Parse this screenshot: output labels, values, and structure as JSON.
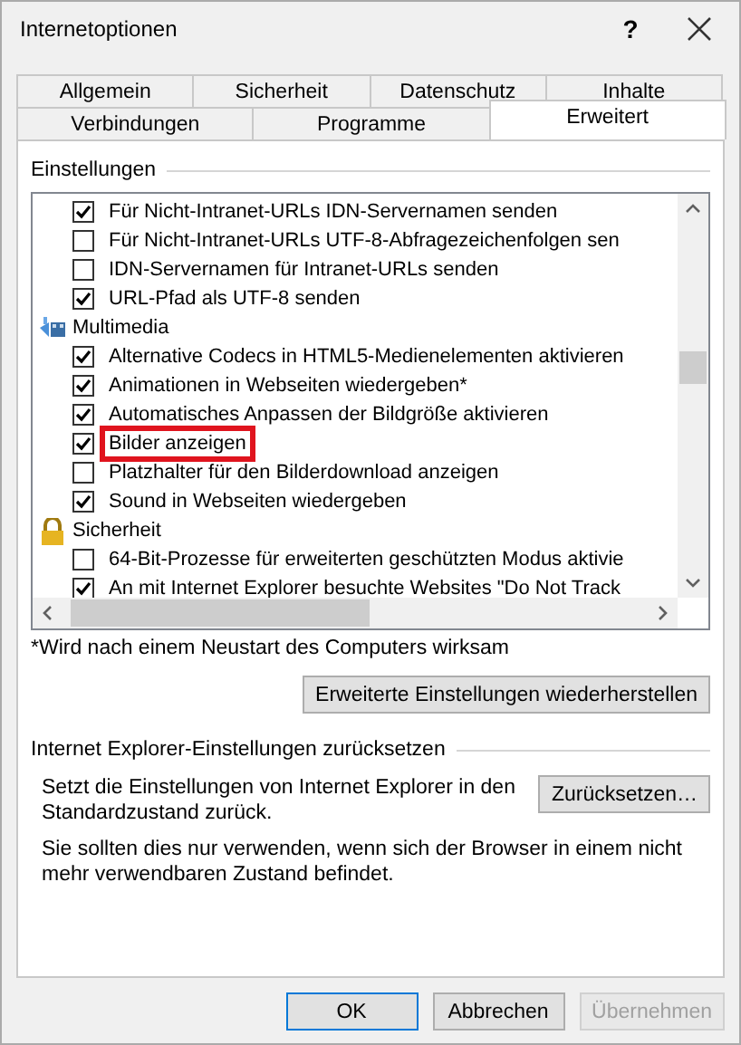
{
  "window": {
    "title": "Internetoptionen",
    "help": "?"
  },
  "tabs": [
    [
      {
        "label": "Allgemein",
        "selected": false
      },
      {
        "label": "Sicherheit",
        "selected": false
      },
      {
        "label": "Datenschutz",
        "selected": false
      },
      {
        "label": "Inhalte",
        "selected": false
      }
    ],
    [
      {
        "label": "Verbindungen",
        "selected": false
      },
      {
        "label": "Programme",
        "selected": false
      },
      {
        "label": "Erweitert",
        "selected": true
      }
    ]
  ],
  "settings": {
    "title": "Einstellungen",
    "items": [
      {
        "kind": "checkbox",
        "label": "Für Nicht-Intranet-URLs IDN-Servernamen senden",
        "checked": true,
        "highlighted": false
      },
      {
        "kind": "checkbox",
        "label": "Für Nicht-Intranet-URLs UTF-8-Abfragezeichenfolgen sen",
        "checked": false,
        "highlighted": false
      },
      {
        "kind": "checkbox",
        "label": "IDN-Servernamen für Intranet-URLs senden",
        "checked": false,
        "highlighted": false
      },
      {
        "kind": "checkbox",
        "label": "URL-Pfad als UTF-8 senden",
        "checked": true,
        "highlighted": false
      },
      {
        "kind": "category",
        "label": "Multimedia"
      },
      {
        "kind": "checkbox",
        "label": "Alternative Codecs in HTML5-Medienelementen aktivieren",
        "checked": true,
        "highlighted": false
      },
      {
        "kind": "checkbox",
        "label": "Animationen in Webseiten wiedergeben*",
        "checked": true,
        "highlighted": false
      },
      {
        "kind": "checkbox",
        "label": "Automatisches Anpassen der Bildgröße aktivieren",
        "checked": true,
        "highlighted": false
      },
      {
        "kind": "checkbox",
        "label": "Bilder anzeigen",
        "checked": true,
        "highlighted": true
      },
      {
        "kind": "checkbox",
        "label": "Platzhalter für den Bilderdownload anzeigen",
        "checked": false,
        "highlighted": false
      },
      {
        "kind": "checkbox",
        "label": "Sound in Webseiten wiedergeben",
        "checked": true,
        "highlighted": false
      },
      {
        "kind": "category",
        "label": "Sicherheit"
      },
      {
        "kind": "checkbox",
        "label": "64-Bit-Prozesse für erweiterten geschützten Modus aktivie",
        "checked": false,
        "highlighted": false
      },
      {
        "kind": "checkbox",
        "label": "An mit Internet Explorer besuchte Websites \"Do Not Track",
        "checked": true,
        "highlighted": false
      }
    ],
    "footnote": "*Wird nach einem Neustart des Computers wirksam",
    "restore_button": "Erweiterte Einstellungen wiederherstellen"
  },
  "reset": {
    "title": "Internet Explorer-Einstellungen zurücksetzen",
    "description": "Setzt die Einstellungen von Internet Explorer in den Standardzustand zurück.",
    "button": "Zurücksetzen…",
    "warning": "Sie sollten dies nur verwenden, wenn sich der Browser in einem nicht mehr verwendbaren Zustand befindet."
  },
  "buttons": [
    {
      "label": "OK",
      "focused": true,
      "disabled": false
    },
    {
      "label": "Abbrechen",
      "focused": false,
      "disabled": false
    },
    {
      "label": "Übernehmen",
      "focused": false,
      "disabled": true
    }
  ]
}
